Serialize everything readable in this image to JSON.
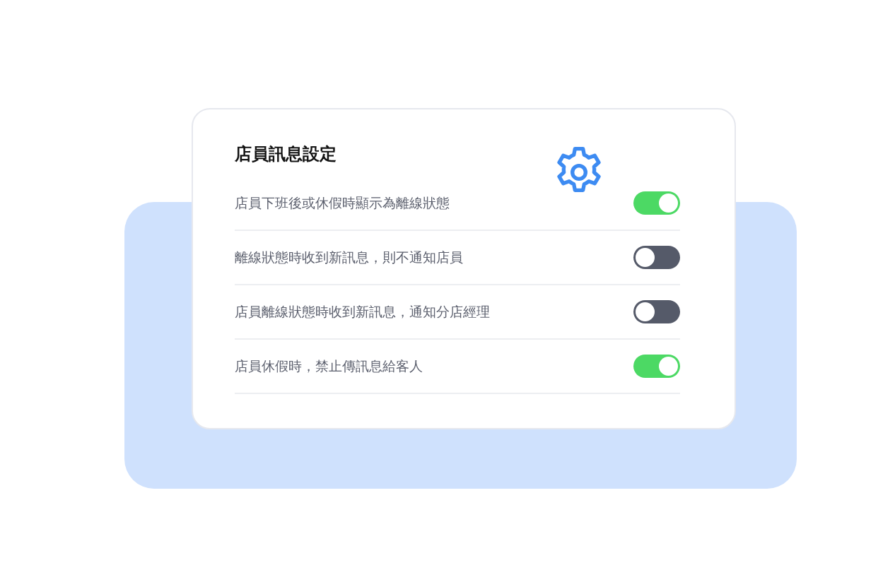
{
  "card": {
    "title": "店員訊息設定",
    "settings": [
      {
        "label": "店員下班後或休假時顯示為離線狀態",
        "on": true
      },
      {
        "label": "離線狀態時收到新訊息，則不通知店員",
        "on": false
      },
      {
        "label": "店員離線狀態時收到新訊息，通知分店經理",
        "on": false
      },
      {
        "label": "店員休假時，禁止傳訊息給客人",
        "on": true
      }
    ]
  }
}
